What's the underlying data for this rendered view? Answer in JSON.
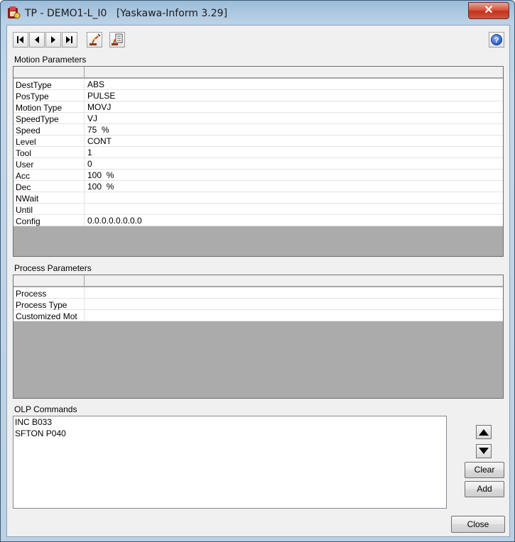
{
  "window": {
    "title": "TP - DEMO1-L_I0   [Yaskawa-Inform 3.29]",
    "close_glyph": "✕"
  },
  "toolbar": {
    "buttons": [
      {
        "name": "first-record-button",
        "icon": "skip-first-icon"
      },
      {
        "name": "previous-record-button",
        "icon": "step-back-icon"
      },
      {
        "name": "next-record-button",
        "icon": "step-forward-icon"
      },
      {
        "name": "last-record-button",
        "icon": "skip-last-icon"
      },
      {
        "name": "robot-teach-button",
        "icon": "robot-arm-icon"
      },
      {
        "name": "robot-program-button",
        "icon": "robot-program-icon"
      }
    ],
    "help_glyph": "?"
  },
  "motion": {
    "label": "Motion Parameters",
    "rows": [
      {
        "name": "DestType",
        "value": "ABS"
      },
      {
        "name": "PosType",
        "value": "PULSE"
      },
      {
        "name": "Motion Type",
        "value": "MOVJ"
      },
      {
        "name": "SpeedType",
        "value": "VJ"
      },
      {
        "name": "Speed",
        "value": "75  %"
      },
      {
        "name": "Level",
        "value": "CONT"
      },
      {
        "name": "Tool",
        "value": "1"
      },
      {
        "name": "User",
        "value": "0"
      },
      {
        "name": "Acc",
        "value": "100  %"
      },
      {
        "name": "Dec",
        "value": "100  %"
      },
      {
        "name": "NWait",
        "value": ""
      },
      {
        "name": "Until",
        "value": ""
      },
      {
        "name": "Config",
        "value": "0.0.0.0.0.0.0.0"
      }
    ]
  },
  "process": {
    "label": "Process Parameters",
    "rows": [
      {
        "name": "Process",
        "value": ""
      },
      {
        "name": "Process Type",
        "value": ""
      },
      {
        "name": "Customized Mot",
        "value": ""
      }
    ]
  },
  "olp": {
    "label": "OLP Commands",
    "lines": [
      "INC B033",
      "SFTON P040"
    ],
    "up_glyph": "▲",
    "down_glyph": "▼",
    "clear_label": "Clear",
    "add_label": "Add"
  },
  "footer": {
    "close_label": "Close"
  },
  "colors": {
    "grid_empty": "#ababab",
    "dialog_bg": "#f0f0f0",
    "title_close": "#c9402a"
  }
}
